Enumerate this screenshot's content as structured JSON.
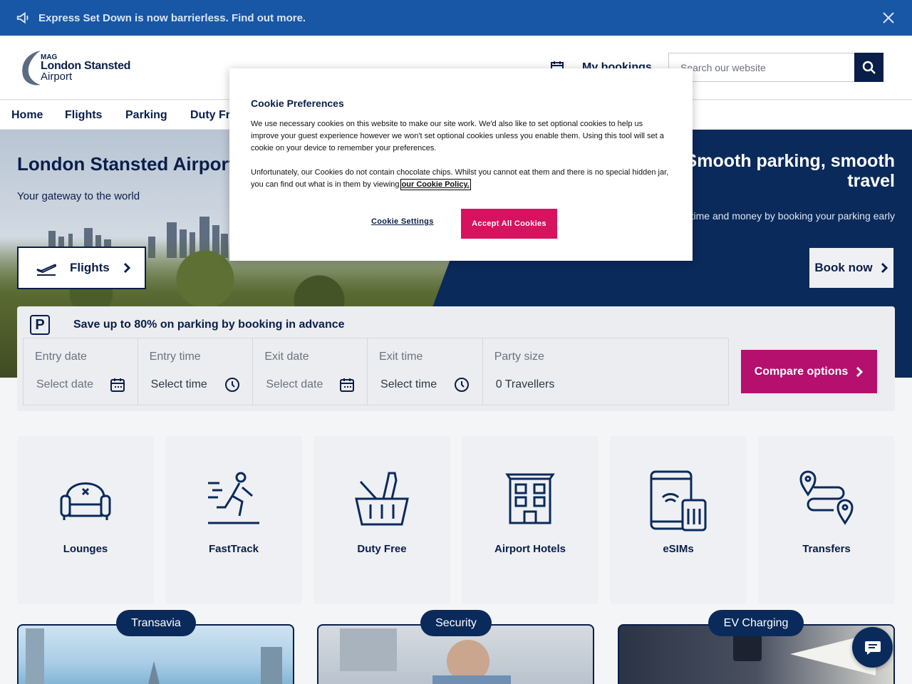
{
  "banner": {
    "text": "Express Set Down is now barrierless. Find out more."
  },
  "header": {
    "logo": {
      "mag": "MAG",
      "line1": "London Stansted",
      "line2": "Airport"
    },
    "my_bookings": "My bookings",
    "search_placeholder": "Search our website"
  },
  "nav": {
    "items": [
      "Home",
      "Flights",
      "Parking",
      "Duty Fr"
    ]
  },
  "hero": {
    "title": "London Stansted Airport",
    "subtitle": "Your gateway to the world",
    "flights_button": "Flights",
    "promo_title": "Smooth parking, smooth travel",
    "promo_text": "ve time and money by booking your parking early",
    "book_button": "Book now"
  },
  "parking": {
    "heading": "Save up to 80% on parking by booking in advance",
    "icon_letter": "P",
    "fields": [
      {
        "label": "Entry date",
        "value": "Select date",
        "icon": "calendar-icon"
      },
      {
        "label": "Entry time",
        "value": "Select time",
        "icon": "clock-icon"
      },
      {
        "label": "Exit date",
        "value": "Select date",
        "icon": "calendar-icon"
      },
      {
        "label": "Exit time",
        "value": "Select time",
        "icon": "clock-icon"
      },
      {
        "label": "Party size",
        "value": "0 Travellers"
      }
    ],
    "compare_button": "Compare options"
  },
  "services": [
    {
      "label": "Lounges",
      "icon": "armchair-icon"
    },
    {
      "label": "FastTrack",
      "icon": "running-person-icon"
    },
    {
      "label": "Duty Free",
      "icon": "basket-icon"
    },
    {
      "label": "Airport Hotels",
      "icon": "hotel-icon"
    },
    {
      "label": "eSIMs",
      "icon": "esim-icon"
    },
    {
      "label": "Transfers",
      "icon": "route-icon"
    }
  ],
  "cards": [
    {
      "label": "Transavia"
    },
    {
      "label": "Security"
    },
    {
      "label": "EV Charging"
    }
  ],
  "cookie": {
    "title": "Cookie Preferences",
    "para1": "We use necessary cookies on this website to make our site work. We'd also like to set optional cookies to help us improve your guest experience however we won't set optional cookies unless you enable them. Using this tool will set a cookie on your device to remember your preferences.",
    "para2": "Unfortunately, our Cookies do not contain chocolate chips. Whilst you cannot eat them and there is no special hidden jar, you can find out what is in them by viewing",
    "policy_link": "our Cookie Policy.",
    "settings_button": "Cookie Settings",
    "accept_button": "Accept All Cookies"
  },
  "colors": {
    "navy": "#0a1e4a",
    "banner_blue": "#1856a6",
    "accent_pink": "#b5106e",
    "cookie_pink": "#d6135f"
  }
}
